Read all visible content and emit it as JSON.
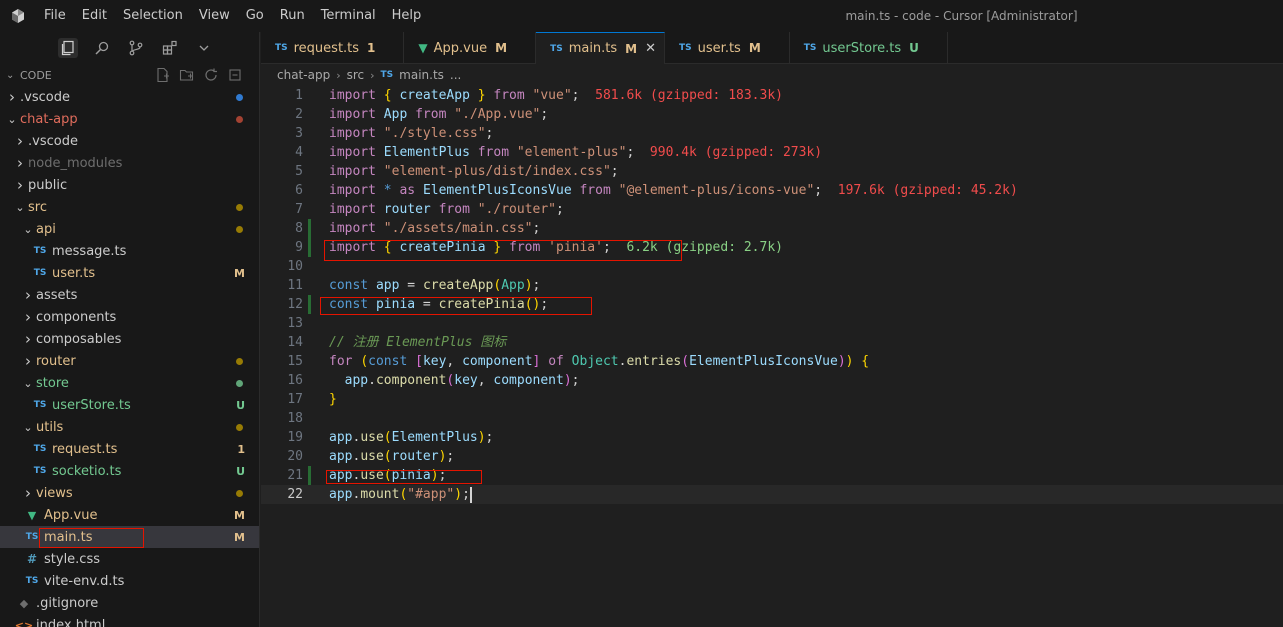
{
  "menu": [
    "File",
    "Edit",
    "Selection",
    "View",
    "Go",
    "Run",
    "Terminal",
    "Help"
  ],
  "window_title": "main.ts - code - Cursor [Administrator]",
  "explorer": {
    "title": "CODE",
    "items": [
      {
        "label": ".vscode",
        "depth": 1,
        "kind": "folder",
        "expanded": false,
        "dot": "#3794ff"
      },
      {
        "label": "chat-app",
        "depth": 1,
        "kind": "folder",
        "expanded": true,
        "dot": "#c74e39"
      },
      {
        "label": ".vscode",
        "depth": 2,
        "kind": "folder",
        "expanded": false
      },
      {
        "label": "node_modules",
        "depth": 2,
        "kind": "folder",
        "expanded": false,
        "dim": true
      },
      {
        "label": "public",
        "depth": 2,
        "kind": "folder",
        "expanded": false
      },
      {
        "label": "src",
        "depth": 2,
        "kind": "folder",
        "expanded": true,
        "dot": "#b89500"
      },
      {
        "label": "api",
        "depth": 3,
        "kind": "folder",
        "expanded": true,
        "dot": "#b89500"
      },
      {
        "label": "message.ts",
        "depth": 4,
        "kind": "ts"
      },
      {
        "label": "user.ts",
        "depth": 4,
        "kind": "ts",
        "badge": "M",
        "badge_color": "#e2c08d"
      },
      {
        "label": "assets",
        "depth": 3,
        "kind": "folder",
        "expanded": false
      },
      {
        "label": "components",
        "depth": 3,
        "kind": "folder",
        "expanded": false
      },
      {
        "label": "composables",
        "depth": 3,
        "kind": "folder",
        "expanded": false
      },
      {
        "label": "router",
        "depth": 3,
        "kind": "folder",
        "expanded": false,
        "dot": "#b89500"
      },
      {
        "label": "store",
        "depth": 3,
        "kind": "folder",
        "expanded": true,
        "dot": "#73c991"
      },
      {
        "label": "userStore.ts",
        "depth": 4,
        "kind": "ts",
        "badge": "U",
        "badge_color": "#73c991"
      },
      {
        "label": "utils",
        "depth": 3,
        "kind": "folder",
        "expanded": true,
        "dot": "#b89500"
      },
      {
        "label": "request.ts",
        "depth": 4,
        "kind": "ts",
        "badge": "1",
        "badge_color": "#e2c08d"
      },
      {
        "label": "socketio.ts",
        "depth": 4,
        "kind": "ts",
        "badge": "U",
        "badge_color": "#73c991"
      },
      {
        "label": "views",
        "depth": 3,
        "kind": "folder",
        "expanded": false,
        "dot": "#b89500"
      },
      {
        "label": "App.vue",
        "depth": 3,
        "kind": "vue",
        "badge": "M",
        "badge_color": "#e2c08d"
      },
      {
        "label": "main.ts",
        "depth": 3,
        "kind": "ts",
        "badge": "M",
        "badge_color": "#e2c08d",
        "selected": true
      },
      {
        "label": "style.css",
        "depth": 3,
        "kind": "css"
      },
      {
        "label": "vite-env.d.ts",
        "depth": 3,
        "kind": "ts"
      },
      {
        "label": ".gitignore",
        "depth": 2,
        "kind": "git"
      },
      {
        "label": "index.html",
        "depth": 2,
        "kind": "html"
      }
    ]
  },
  "tabs": [
    {
      "label": "request.ts",
      "kind": "ts",
      "mark": "1",
      "mark_color": "#e2c08d"
    },
    {
      "label": "App.vue",
      "kind": "vue",
      "mark": "M",
      "mark_color": "#e2c08d"
    },
    {
      "label": "main.ts",
      "kind": "ts",
      "mark": "M",
      "mark_color": "#e2c08d",
      "active": true
    },
    {
      "label": "user.ts",
      "kind": "ts",
      "mark": "M",
      "mark_color": "#e2c08d"
    },
    {
      "label": "userStore.ts",
      "kind": "ts",
      "mark": "U",
      "mark_color": "#73c991"
    }
  ],
  "breadcrumb": [
    "chat-app",
    "src",
    "main.ts",
    "..."
  ],
  "code": [
    [
      [
        "kw",
        "import"
      ],
      [
        "plain",
        " "
      ],
      [
        "br1",
        "{"
      ],
      [
        "plain",
        " "
      ],
      [
        "var",
        "createApp"
      ],
      [
        "plain",
        " "
      ],
      [
        "br1",
        "}"
      ],
      [
        "plain",
        " "
      ],
      [
        "kw",
        "from"
      ],
      [
        "plain",
        " "
      ],
      [
        "str",
        "\"vue\""
      ],
      [
        "plain",
        ";"
      ],
      [
        "hint",
        "  581.6k (gzipped: 183.3k)"
      ]
    ],
    [
      [
        "kw",
        "import"
      ],
      [
        "plain",
        " "
      ],
      [
        "var",
        "App"
      ],
      [
        "plain",
        " "
      ],
      [
        "kw",
        "from"
      ],
      [
        "plain",
        " "
      ],
      [
        "str",
        "\"./App.vue\""
      ],
      [
        "plain",
        ";"
      ]
    ],
    [
      [
        "kw",
        "import"
      ],
      [
        "plain",
        " "
      ],
      [
        "str",
        "\"./style.css\""
      ],
      [
        "plain",
        ";"
      ]
    ],
    [
      [
        "kw",
        "import"
      ],
      [
        "plain",
        " "
      ],
      [
        "var",
        "ElementPlus"
      ],
      [
        "plain",
        " "
      ],
      [
        "kw",
        "from"
      ],
      [
        "plain",
        " "
      ],
      [
        "str",
        "\"element-plus\""
      ],
      [
        "plain",
        ";"
      ],
      [
        "hint",
        "  990.4k (gzipped: 273k)"
      ]
    ],
    [
      [
        "kw",
        "import"
      ],
      [
        "plain",
        " "
      ],
      [
        "str",
        "\"element-plus/dist/index.css\""
      ],
      [
        "plain",
        ";"
      ]
    ],
    [
      [
        "kw",
        "import"
      ],
      [
        "plain",
        " "
      ],
      [
        "blue",
        "*"
      ],
      [
        "plain",
        " "
      ],
      [
        "kw",
        "as"
      ],
      [
        "plain",
        " "
      ],
      [
        "var",
        "ElementPlusIconsVue"
      ],
      [
        "plain",
        " "
      ],
      [
        "kw",
        "from"
      ],
      [
        "plain",
        " "
      ],
      [
        "str",
        "\"@element-plus/icons-vue\""
      ],
      [
        "plain",
        ";"
      ],
      [
        "hint",
        "  197.6k (gzipped: 45.2k)"
      ]
    ],
    [
      [
        "kw",
        "import"
      ],
      [
        "plain",
        " "
      ],
      [
        "var",
        "router"
      ],
      [
        "plain",
        " "
      ],
      [
        "kw",
        "from"
      ],
      [
        "plain",
        " "
      ],
      [
        "str",
        "\"./router\""
      ],
      [
        "plain",
        ";"
      ]
    ],
    [
      [
        "kw",
        "import"
      ],
      [
        "plain",
        " "
      ],
      [
        "str",
        "\"./assets/main.css\""
      ],
      [
        "plain",
        ";"
      ]
    ],
    [
      [
        "kw",
        "import"
      ],
      [
        "plain",
        " "
      ],
      [
        "br1",
        "{"
      ],
      [
        "plain",
        " "
      ],
      [
        "var",
        "createPinia"
      ],
      [
        "plain",
        " "
      ],
      [
        "br1",
        "}"
      ],
      [
        "plain",
        " "
      ],
      [
        "kw",
        "from"
      ],
      [
        "plain",
        " "
      ],
      [
        "str",
        "'pinia'"
      ],
      [
        "plain",
        ";"
      ],
      [
        "hint-green",
        "  6.2k (gzipped: 2.7k)"
      ]
    ],
    [],
    [
      [
        "blue",
        "const"
      ],
      [
        "plain",
        " "
      ],
      [
        "var",
        "app"
      ],
      [
        "plain",
        " = "
      ],
      [
        "fn",
        "createApp"
      ],
      [
        "br1",
        "("
      ],
      [
        "cls",
        "App"
      ],
      [
        "br1",
        ")"
      ],
      [
        "plain",
        ";"
      ]
    ],
    [
      [
        "blue",
        "const"
      ],
      [
        "plain",
        " "
      ],
      [
        "var",
        "pinia"
      ],
      [
        "plain",
        " = "
      ],
      [
        "fn",
        "createPinia"
      ],
      [
        "br1",
        "()"
      ],
      [
        "plain",
        ";"
      ]
    ],
    [],
    [
      [
        "cmt",
        "// 注册 ElementPlus 图标"
      ]
    ],
    [
      [
        "kw",
        "for"
      ],
      [
        "plain",
        " "
      ],
      [
        "br1",
        "("
      ],
      [
        "blue",
        "const"
      ],
      [
        "plain",
        " "
      ],
      [
        "br2",
        "["
      ],
      [
        "var",
        "key"
      ],
      [
        "plain",
        ", "
      ],
      [
        "var",
        "component"
      ],
      [
        "br2",
        "]"
      ],
      [
        "plain",
        " "
      ],
      [
        "kw",
        "of"
      ],
      [
        "plain",
        " "
      ],
      [
        "cls",
        "Object"
      ],
      [
        "plain",
        "."
      ],
      [
        "fn",
        "entries"
      ],
      [
        "br2",
        "("
      ],
      [
        "var",
        "ElementPlusIconsVue"
      ],
      [
        "br2",
        ")"
      ],
      [
        "br1",
        ")"
      ],
      [
        "plain",
        " "
      ],
      [
        "br1",
        "{"
      ]
    ],
    [
      [
        "plain",
        "  "
      ],
      [
        "var",
        "app"
      ],
      [
        "plain",
        "."
      ],
      [
        "fn",
        "component"
      ],
      [
        "br2",
        "("
      ],
      [
        "var",
        "key"
      ],
      [
        "plain",
        ", "
      ],
      [
        "var",
        "component"
      ],
      [
        "br2",
        ")"
      ],
      [
        "plain",
        ";"
      ]
    ],
    [
      [
        "br1",
        "}"
      ]
    ],
    [],
    [
      [
        "var",
        "app"
      ],
      [
        "plain",
        "."
      ],
      [
        "fn",
        "use"
      ],
      [
        "br1",
        "("
      ],
      [
        "var",
        "ElementPlus"
      ],
      [
        "br1",
        ")"
      ],
      [
        "plain",
        ";"
      ]
    ],
    [
      [
        "var",
        "app"
      ],
      [
        "plain",
        "."
      ],
      [
        "fn",
        "use"
      ],
      [
        "br1",
        "("
      ],
      [
        "var",
        "router"
      ],
      [
        "br1",
        ")"
      ],
      [
        "plain",
        ";"
      ]
    ],
    [
      [
        "var",
        "app"
      ],
      [
        "plain",
        "."
      ],
      [
        "fn",
        "use"
      ],
      [
        "br1",
        "("
      ],
      [
        "var",
        "pinia"
      ],
      [
        "br1",
        ")"
      ],
      [
        "plain",
        ";"
      ]
    ],
    [
      [
        "var",
        "app"
      ],
      [
        "plain",
        "."
      ],
      [
        "fn",
        "mount"
      ],
      [
        "br1",
        "("
      ],
      [
        "str",
        "\"#app\""
      ],
      [
        "br1",
        ")"
      ],
      [
        "plain",
        ";"
      ]
    ]
  ],
  "modified_lines": [
    8,
    9,
    12,
    21
  ],
  "current_line": 22
}
